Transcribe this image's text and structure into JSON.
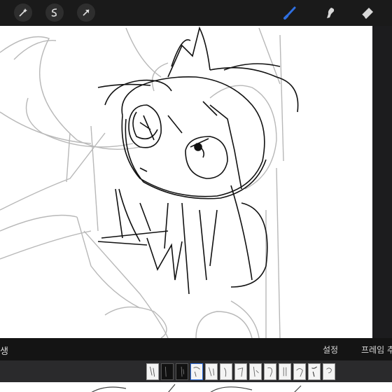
{
  "toolbar": {
    "left_tools": [
      "adjustments-wand-icon",
      "selection-s-icon",
      "transform-arrow-icon"
    ],
    "right_tools": [
      "brush-icon",
      "smudge-icon",
      "eraser-icon"
    ],
    "active_tool": "brush",
    "accent_color": "#2f6fe0"
  },
  "animation": {
    "left_label": "생",
    "settings_label": "설정",
    "add_frame_label": "프레임 추"
  },
  "timeline": {
    "frame_count": 13,
    "frames_dark": [
      1,
      2
    ],
    "selected_frame": 4
  }
}
